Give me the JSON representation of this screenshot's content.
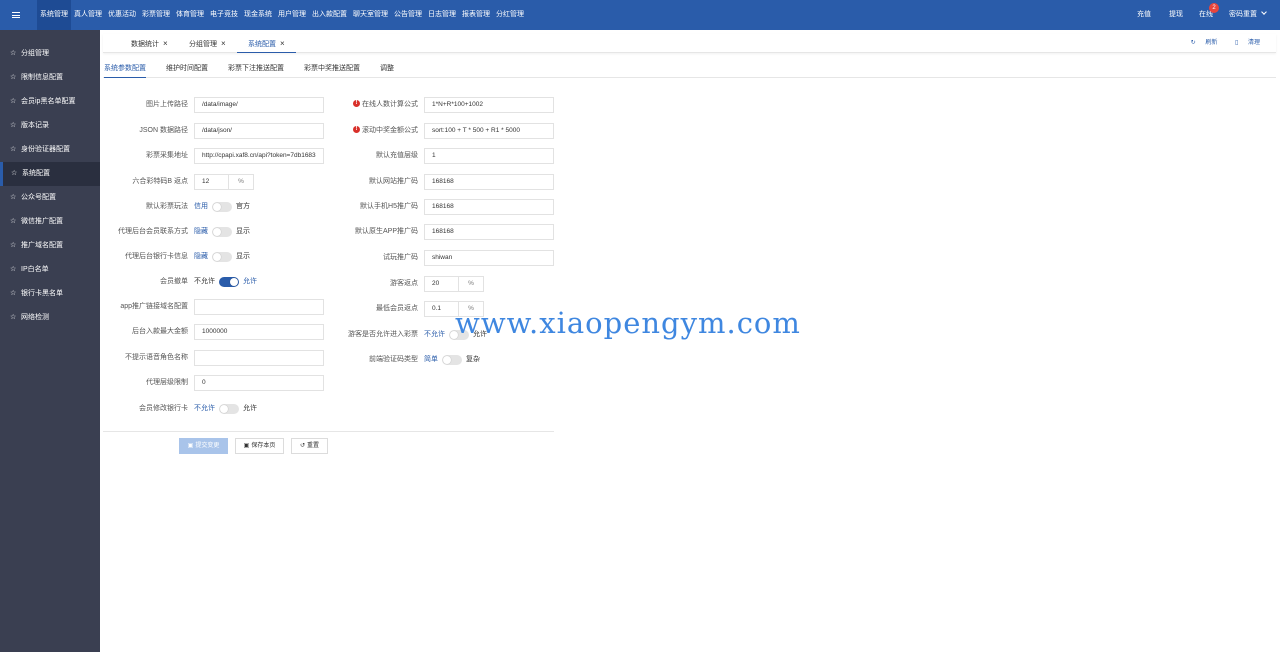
{
  "topnav": {
    "items": [
      "系统管理",
      "真人管理",
      "优惠活动",
      "彩票管理",
      "体育管理",
      "电子竞技",
      "现金系统",
      "用户管理",
      "出入款配置",
      "聊天室管理",
      "公告管理",
      "日志管理",
      "报表管理",
      "分红管理"
    ],
    "right": {
      "recharge": "充值",
      "withdraw": "提现",
      "online": "在线",
      "online_badge": "2",
      "user": "密码重置"
    }
  },
  "sidebar": {
    "items": [
      "分组管理",
      "限制信息配置",
      "会员ip黑名单配置",
      "版本记录",
      "身份验证器配置",
      "系统配置",
      "公众号配置",
      "微信推广配置",
      "推广域名配置",
      "IP白名单",
      "银行卡黑名单",
      "网络检测"
    ]
  },
  "tabs": {
    "items": [
      "数据统计",
      "分组管理",
      "系统配置"
    ],
    "refresh": "刷新",
    "clear": "清理"
  },
  "subtabs": [
    "系统参数配置",
    "维护时间配置",
    "彩票下注推送配置",
    "彩票中奖推送配置",
    "调整"
  ],
  "form_left": {
    "image_path": {
      "label": "图片上传路径",
      "value": "/data/image/"
    },
    "json_path": {
      "label": "JSON 数据路径",
      "value": "/data/json/"
    },
    "lottery_url": {
      "label": "彩票采集地址",
      "value": "http://cpapi.xaf8.cn/api?token=7db1683"
    },
    "lhc_rebate": {
      "label": "六合彩特码B 返点",
      "value": "12",
      "unit": "%"
    },
    "default_play": {
      "label": "默认彩票玩法",
      "off": "信用",
      "on": "官方"
    },
    "agent_contact": {
      "label": "代理后台会员联系方式",
      "off": "隐藏",
      "on": "显示"
    },
    "agent_bank": {
      "label": "代理后台银行卡信息",
      "off": "隐藏",
      "on": "显示"
    },
    "member_register": {
      "label": "会员撤单",
      "off": "不允许",
      "on": "允许"
    },
    "app_domain": {
      "label": "app推广链接域名配置",
      "value": ""
    },
    "max_deposit": {
      "label": "后台入款最大金额",
      "value": "1000000"
    },
    "no_voice_roles": {
      "label": "不提示语音角色名称",
      "value": ""
    },
    "agent_levels": {
      "label": "代理层级限制",
      "value": "0"
    },
    "member_bank": {
      "label": "会员修改银行卡",
      "off": "不允许",
      "on": "允许"
    }
  },
  "form_right": {
    "online_formula": {
      "label": "在线人数计算公式",
      "value": "1*N+R*100+1002"
    },
    "scroll_formula": {
      "label": "滚动中奖金额公式",
      "value": "sort:100 + T * 500 + R1 * 5000"
    },
    "recharge_level": {
      "label": "默认充值层级",
      "value": "1"
    },
    "site_code": {
      "label": "默认网站推广码",
      "value": "168168"
    },
    "h5_code": {
      "label": "默认手机H5推广码",
      "value": "168168"
    },
    "app_code": {
      "label": "默认原生APP推广码",
      "value": "168168"
    },
    "trial_code": {
      "label": "试玩推广码",
      "value": "shiwan"
    },
    "guest_rebate": {
      "label": "游客返点",
      "value": "20",
      "unit": "%"
    },
    "min_rebate": {
      "label": "最低会员返点",
      "value": "0.1",
      "unit": "%"
    },
    "guest_lottery": {
      "label": "游客是否允许进入彩票",
      "off": "不允许",
      "on": "允许"
    },
    "captcha_type": {
      "label": "前端验证码类型",
      "off": "简单",
      "on": "复杂"
    }
  },
  "buttons": {
    "submit": "提交变更",
    "save": "保存本页",
    "reset": "重置"
  },
  "watermark": "www.xiaopengym.com",
  "colors": {
    "primary": "#2a5caa",
    "sidebar": "#3a3f51",
    "required": "#d9302a"
  }
}
